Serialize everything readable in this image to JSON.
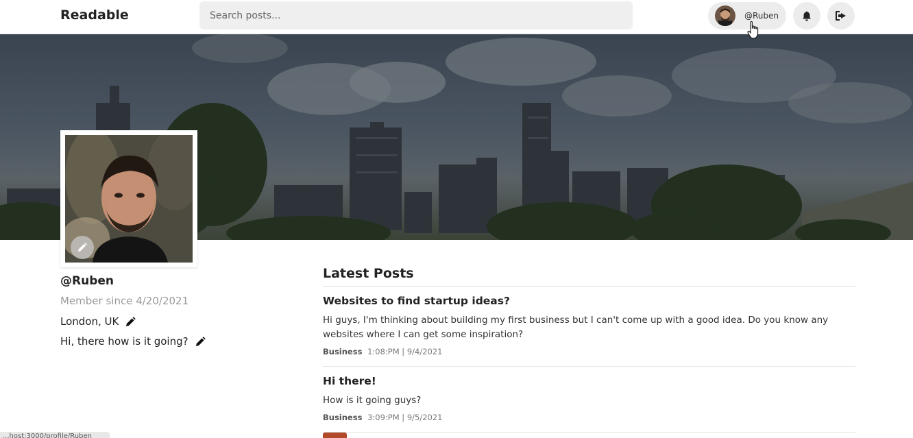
{
  "app": {
    "brand": "Readable"
  },
  "search": {
    "placeholder": "Search posts..."
  },
  "header_user": {
    "handle": "@Ruben"
  },
  "profile": {
    "username": "@Ruben",
    "member_since": "Member since 4/20/2021",
    "location": "London, UK",
    "bio": "Hi, there how is it going?"
  },
  "posts_section": {
    "title": "Latest Posts",
    "posts": [
      {
        "title": "Websites to find startup ideas?",
        "body": "Hi guys, I'm thinking about building my first business but I can't come up with a good idea. Do you know any websites where I can get some inspiration?",
        "category": "Business",
        "timestamp": "1:08:PM | 9/4/2021"
      },
      {
        "title": "Hi there!",
        "body": "How is it going guys?",
        "category": "Business",
        "timestamp": "3:09:PM | 9/5/2021"
      }
    ]
  },
  "status_bar": {
    "url": "...host:3000/profile/Ruben"
  },
  "colors": {
    "accent_stub": "#b24a2a",
    "pill_bg": "#ececec",
    "muted_text": "#999999"
  },
  "icons": {
    "bell": "bell-icon",
    "logout": "logout-icon",
    "edit": "pencil-icon"
  }
}
